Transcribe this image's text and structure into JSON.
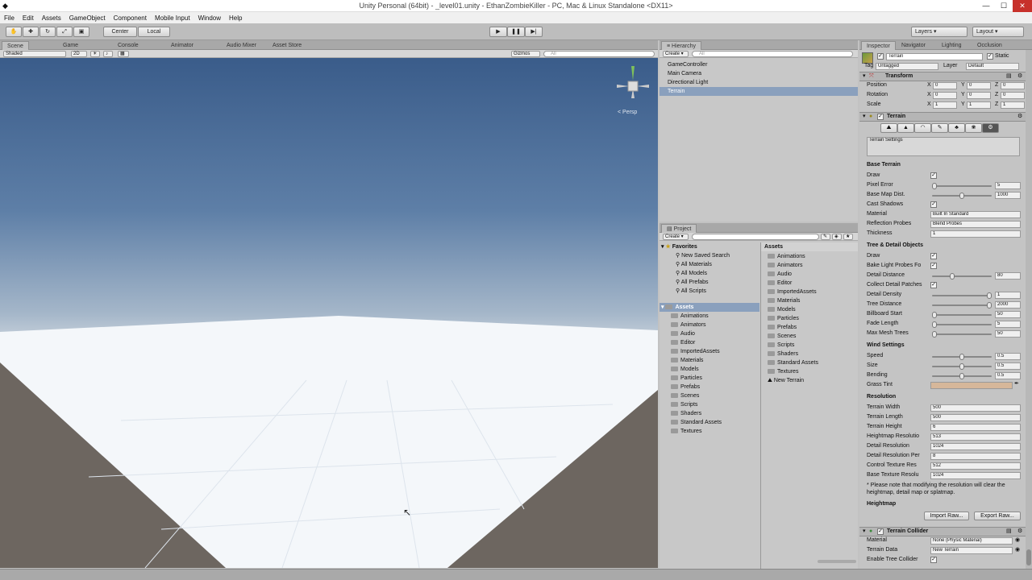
{
  "window": {
    "title": "Unity Personal (64bit) - _level01.unity - EthanZombieKiller - PC, Mac & Linux Standalone <DX11>"
  },
  "menu": [
    "File",
    "Edit",
    "Assets",
    "GameObject",
    "Component",
    "Mobile Input",
    "Window",
    "Help"
  ],
  "toolbar": {
    "center": "Center",
    "local": "Local",
    "layers": "Layers",
    "layout": "Layout"
  },
  "scene": {
    "tabs": [
      "Scene",
      "Game",
      "Console",
      "Animator",
      "Audio Mixer",
      "Asset Store"
    ],
    "shaded": "Shaded",
    "mode2d": "2D",
    "gizmos": "Gizmos",
    "search_placeholder": "All",
    "persp": "< Persp"
  },
  "hierarchy": {
    "tab": "Hierarchy",
    "create": "Create",
    "search_placeholder": "All",
    "items": [
      "GameController",
      "Main Camera",
      "Directional Light",
      "Terrain"
    ]
  },
  "project": {
    "tab": "Project",
    "create": "Create",
    "favorites_label": "Favorites",
    "favorites": [
      "New Saved Search",
      "All Materials",
      "All Models",
      "All Prefabs",
      "All Scripts"
    ],
    "assets_label": "Assets",
    "tree": [
      "Animations",
      "Animators",
      "Audio",
      "Editor",
      "ImportedAssets",
      "Materials",
      "Models",
      "Particles",
      "Prefabs",
      "Scenes",
      "Scripts",
      "Shaders",
      "Standard Assets",
      "Textures"
    ],
    "assets_header": "Assets",
    "grid": [
      "Animations",
      "Animators",
      "Audio",
      "Editor",
      "ImportedAssets",
      "Materials",
      "Models",
      "Particles",
      "Prefabs",
      "Scenes",
      "Scripts",
      "Shaders",
      "Standard Assets",
      "Textures",
      "New Terrain"
    ]
  },
  "inspector": {
    "tabs": [
      "Inspector",
      "Navigator",
      "Lighting",
      "Occlusion"
    ],
    "object_name": "Terrain",
    "static": "Static",
    "tag_label": "Tag",
    "tag": "Untagged",
    "layer_label": "Layer",
    "layer": "Default",
    "transform": {
      "title": "Transform",
      "rows": [
        {
          "label": "Position",
          "x": "0",
          "y": "0",
          "z": "0"
        },
        {
          "label": "Rotation",
          "x": "0",
          "y": "0",
          "z": "0"
        },
        {
          "label": "Scale",
          "x": "1",
          "y": "1",
          "z": "1"
        }
      ]
    },
    "terrain": {
      "title": "Terrain",
      "settings_label": "Terrain Settings",
      "base_terrain": "Base Terrain",
      "draw": "Draw",
      "pixel_error": "Pixel Error",
      "pixel_error_val": "5",
      "basemap_dist": "Base Map Dist.",
      "basemap_dist_val": "1000",
      "cast_shadows": "Cast Shadows",
      "material": "Material",
      "material_val": "Built In Standard",
      "reflection": "Reflection Probes",
      "reflection_val": "Blend Probes",
      "thickness": "Thickness",
      "thickness_val": "1",
      "tree_detail": "Tree & Detail Objects",
      "draw2": "Draw",
      "bake_light": "Bake Light Probes Fo",
      "detail_distance": "Detail Distance",
      "detail_distance_val": "80",
      "collect_detail": "Collect Detail Patches",
      "detail_density": "Detail Density",
      "detail_density_val": "1",
      "tree_distance": "Tree Distance",
      "tree_distance_val": "2000",
      "billboard_start": "Billboard Start",
      "billboard_start_val": "50",
      "fade_length": "Fade Length",
      "fade_length_val": "5",
      "max_mesh": "Max Mesh Trees",
      "max_mesh_val": "50",
      "wind": "Wind Settings",
      "speed": "Speed",
      "speed_val": "0.5",
      "size": "Size",
      "size_val": "0.5",
      "bending": "Bending",
      "bending_val": "0.5",
      "grass_tint": "Grass Tint",
      "grass_tint_color": "#d6b79a",
      "resolution": "Resolution",
      "res_rows": [
        {
          "label": "Terrain Width",
          "val": "500"
        },
        {
          "label": "Terrain Length",
          "val": "500"
        },
        {
          "label": "Terrain Height",
          "val": "6"
        },
        {
          "label": "Heightmap Resolutio",
          "val": "513"
        },
        {
          "label": "Detail Resolution",
          "val": "1024"
        },
        {
          "label": "Detail Resolution Per",
          "val": "8"
        },
        {
          "label": "Control Texture Res",
          "val": "512"
        },
        {
          "label": "Base Texture Resolu",
          "val": "1024"
        }
      ],
      "note": "* Please note that modifying the resolution will clear the heightmap, detail map or splatmap.",
      "heightmap": "Heightmap",
      "import_raw": "Import Raw...",
      "export_raw": "Export Raw..."
    },
    "collider": {
      "title": "Terrain Collider",
      "material": "Material",
      "material_val": "None (Physic Material)",
      "data": "Terrain Data",
      "data_val": "New Terrain",
      "enable_tree": "Enable Tree Collider"
    }
  }
}
